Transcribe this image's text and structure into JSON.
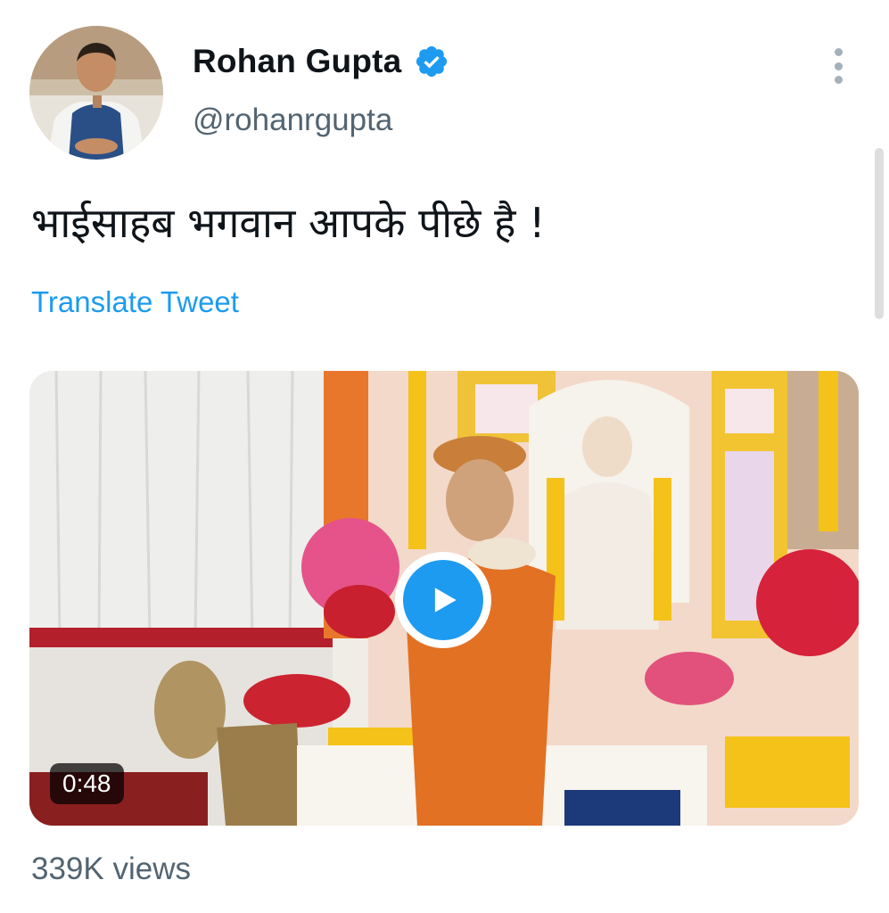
{
  "tweet": {
    "author": {
      "display_name": "Rohan Gupta",
      "handle": "@rohanrgupta",
      "verified": true,
      "avatar_icon": "avatar-photo"
    },
    "text": "भाईसाहब भगवान आपके पीछे है !",
    "translate_label": "Translate Tweet",
    "media": {
      "type": "video",
      "duration": "0:48",
      "play_icon": "play-icon"
    },
    "views": "339K views"
  },
  "colors": {
    "link": "#1d9bf0",
    "verified": "#1d9bf0",
    "secondary_text": "#536471",
    "primary_text": "#0f1419",
    "play_button": "#1d9bf0"
  },
  "icons": {
    "verified": "verified-badge-icon",
    "more": "more-vertical-icon"
  }
}
